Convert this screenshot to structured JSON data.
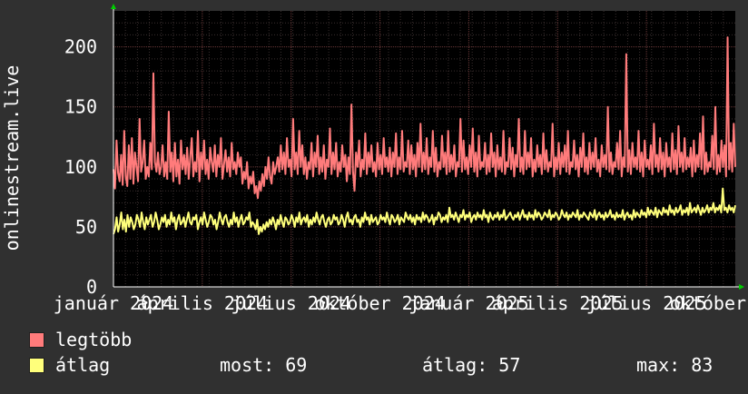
{
  "chart_data": {
    "type": "line",
    "ylabel": "onlinestream.live",
    "ylim": [
      0,
      230
    ],
    "yticks": [
      0,
      50,
      100,
      150,
      200
    ],
    "x_tick_labels": [
      "január 2024",
      "április 2024",
      "július 2024",
      "október 2024",
      "január 2025",
      "április 2025",
      "július 2025",
      "október 2025"
    ],
    "grid": true,
    "series": [
      {
        "name": "legtöbb",
        "color": "#ff7b7b",
        "values": [
          98,
          82,
          122,
          95,
          88,
          110,
          85,
          130,
          92,
          84,
          118,
          90,
          124,
          86,
          112,
          100,
          88,
          140,
          96,
          104,
          122,
          90,
          100,
          92,
          120,
          98,
          178,
          104,
          96,
          112,
          94,
          100,
          118,
          92,
          104,
          90,
          146,
          96,
          112,
          88,
          120,
          92,
          106,
          86,
          122,
          98,
          110,
          94,
          116,
          90,
          108,
          124,
          92,
          104,
          96,
          130,
          88,
          112,
          98,
          122,
          94,
          106,
          90,
          116,
          104,
          96,
          118,
          92,
          110,
          100,
          124,
          90,
          102,
          114,
          96,
          108,
          92,
          120,
          98,
          104,
          94,
          112,
          100,
          108,
          86,
          96,
          90,
          104,
          82,
          92,
          86,
          96,
          78,
          84,
          74,
          88,
          80,
          94,
          84,
          100,
          90,
          108,
          92,
          86,
          104,
          94,
          100,
          108,
          96,
          118,
          98,
          112,
          94,
          124,
          100,
          106,
          92,
          140,
          98,
          112,
          94,
          130,
          100,
          118,
          94,
          108,
          90,
          104,
          98,
          120,
          92,
          112,
          100,
          126,
          94,
          108,
          96,
          118,
          90,
          106,
          100,
          132,
          94,
          112,
          98,
          120,
          92,
          104,
          96,
          118,
          100,
          110,
          88,
          108,
          94,
          152,
          96,
          80,
          112,
          100,
          122,
          92,
          106,
          98,
          128,
          94,
          112,
          100,
          118,
          96,
          104,
          92,
          120,
          98,
          110,
          94,
          124,
          100,
          108,
          96,
          116,
          92,
          112,
          100,
          128,
          94,
          108,
          98,
          130,
          96,
          104,
          100,
          122,
          94,
          118,
          98,
          110,
          92,
          120,
          100,
          136,
          96,
          112,
          98,
          124,
          94,
          108,
          100,
          130,
          96,
          116,
          92,
          104,
          98,
          126,
          100,
          112,
          94,
          130,
          96,
          110,
          98,
          118,
          92,
          104,
          100,
          140,
          96,
          122,
          98,
          108,
          94,
          118,
          100,
          132,
          96,
          112,
          92,
          126,
          98,
          104,
          100,
          120,
          94,
          110,
          96,
          128,
          100,
          112,
          92,
          118,
          98,
          108,
          96,
          130,
          94,
          104,
          100,
          124,
          98,
          116,
          92,
          110,
          100,
          140,
          96,
          108,
          94,
          130,
          98,
          112,
          100,
          124,
          92,
          106,
          96,
          118,
          100,
          110,
          94,
          128,
          98,
          114,
          96,
          104,
          100,
          136,
          92,
          108,
          98,
          120,
          94,
          112,
          100,
          118,
          96,
          130,
          94,
          104,
          100,
          122,
          98,
          110,
          92,
          116,
          100,
          128,
          96,
          108,
          94,
          120,
          98,
          112,
          100,
          124,
          96,
          106,
          92,
          118,
          100,
          110,
          98,
          150,
          96,
          112,
          94,
          104,
          100,
          120,
          98,
          130,
          92,
          108,
          100,
          194,
          96,
          114,
          94,
          120,
          100,
          108,
          98,
          130,
          96,
          112,
          92,
          122,
          100,
          106,
          98,
          118,
          94,
          136,
          100,
          110,
          96,
          124,
          98,
          112,
          92,
          120,
          100,
          108,
          96,
          128,
          98,
          114,
          94,
          134,
          100,
          112,
          96,
          124,
          98,
          108,
          100,
          116,
          92,
          122,
          96,
          110,
          100,
          128,
          98,
          142,
          94,
          112,
          96,
          104,
          100,
          126,
          98,
          150,
          94,
          110,
          96,
          122,
          100,
          118,
          92,
          208,
          98,
          120,
          96,
          136,
          100
        ]
      },
      {
        "name": "átlag",
        "color": "#ffff7b",
        "values": [
          44,
          48,
          58,
          46,
          52,
          62,
          48,
          56,
          46,
          60,
          50,
          58,
          54,
          48,
          52,
          60,
          56,
          50,
          62,
          54,
          48,
          58,
          52,
          56,
          60,
          50,
          54,
          62,
          56,
          48,
          52,
          58,
          54,
          60,
          50,
          56,
          52,
          62,
          54,
          58,
          48,
          56,
          60,
          52,
          54,
          58,
          50,
          56,
          62,
          54,
          52,
          58,
          56,
          60,
          48,
          54,
          58,
          52,
          62,
          56,
          50,
          54,
          60,
          58,
          52,
          56,
          48,
          54,
          62,
          56,
          52,
          58,
          60,
          54,
          50,
          56,
          52,
          62,
          54,
          58,
          50,
          56,
          60,
          52,
          54,
          58,
          56,
          62,
          50,
          54,
          52,
          48,
          56,
          44,
          50,
          46,
          52,
          48,
          54,
          50,
          56,
          52,
          58,
          54,
          48,
          56,
          52,
          60,
          54,
          50,
          58,
          56,
          52,
          54,
          60,
          56,
          50,
          58,
          54,
          62,
          52,
          56,
          58,
          54,
          60,
          50,
          56,
          52,
          58,
          54,
          62,
          56,
          52,
          58,
          60,
          54,
          50,
          56,
          58,
          52,
          54,
          60,
          56,
          58,
          52,
          54,
          60,
          56,
          50,
          58,
          62,
          54,
          56,
          52,
          58,
          60,
          54,
          56,
          50,
          58,
          54,
          62,
          56,
          58,
          52,
          60,
          54,
          56,
          58,
          52,
          54,
          60,
          56,
          58,
          54,
          62,
          56,
          52,
          60,
          58,
          54,
          56,
          60,
          52,
          58,
          56,
          54,
          62,
          58,
          56,
          60,
          54,
          58,
          52,
          60,
          56,
          58,
          54,
          62,
          56,
          60,
          58,
          54,
          56,
          60,
          52,
          58,
          56,
          62,
          60,
          54,
          58,
          56,
          60,
          54,
          66,
          58,
          60,
          56,
          62,
          58,
          54,
          60,
          58,
          64,
          56,
          60,
          58,
          62,
          54,
          58,
          60,
          56,
          62,
          58,
          60,
          56,
          64,
          58,
          60,
          54,
          62,
          58,
          56,
          60,
          58,
          62,
          56,
          60,
          58,
          64,
          56,
          58,
          60,
          62,
          58,
          56,
          60,
          58,
          62,
          56,
          60,
          64,
          58,
          60,
          56,
          62,
          58,
          60,
          56,
          64,
          58,
          62,
          60,
          56,
          58,
          62,
          60,
          58,
          64,
          56,
          60,
          58,
          62,
          60,
          56,
          58,
          64,
          60,
          58,
          62,
          56,
          60,
          58,
          62,
          60,
          58,
          64,
          56,
          60,
          58,
          62,
          60,
          58,
          56,
          62,
          60,
          58,
          64,
          56,
          60,
          62,
          58,
          60,
          56,
          62,
          58,
          60,
          64,
          58,
          60,
          56,
          62,
          58,
          60,
          58,
          64,
          56,
          60,
          62,
          58,
          60,
          56,
          64,
          58,
          62,
          60,
          58,
          64,
          60,
          62,
          58,
          66,
          60,
          64,
          62,
          60,
          66,
          58,
          64,
          62,
          60,
          66,
          62,
          64,
          60,
          68,
          62,
          64,
          60,
          66,
          62,
          64,
          68,
          60,
          64,
          62,
          66,
          60,
          70,
          62,
          64,
          66,
          62,
          68,
          64,
          60,
          66,
          62,
          64,
          68,
          62,
          66,
          64,
          70,
          62,
          66,
          64,
          68,
          62,
          82,
          64,
          66,
          62,
          68,
          64,
          66,
          62,
          68
        ]
      }
    ]
  },
  "legend": [
    {
      "label": "legtöbb",
      "color": "#ff7b7b"
    },
    {
      "label": "átlag",
      "color": "#ffff7b"
    }
  ],
  "stats": {
    "current": "most: 69",
    "average": "átlag: 57",
    "max": "max: 83"
  }
}
